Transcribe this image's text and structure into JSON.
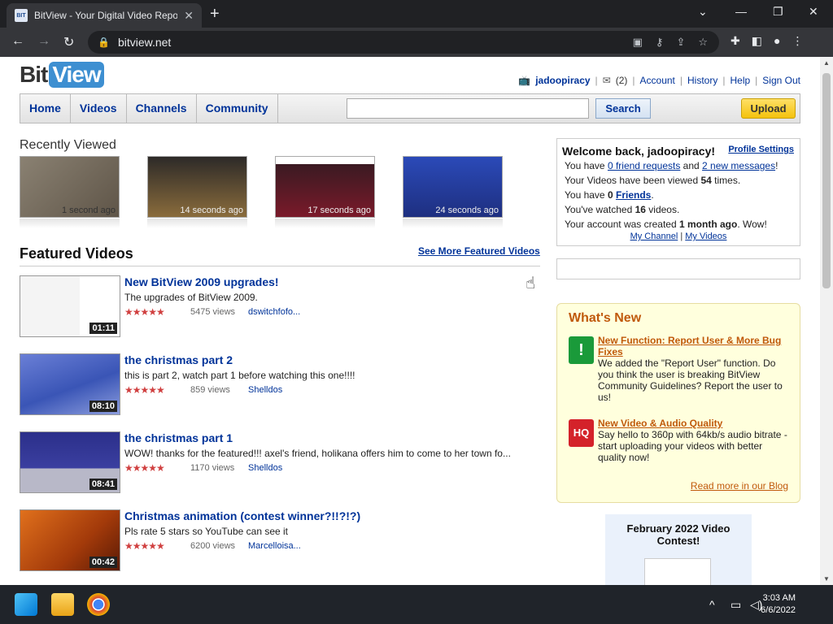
{
  "browser": {
    "tab_title": "BitView - Your Digital Video Repo",
    "favicon_text": "BIT",
    "url": "bitview.net"
  },
  "site": {
    "logo_bit": "Bit",
    "logo_view": "View",
    "user": {
      "username": "jadoopiracy",
      "message_count": "(2)",
      "links": [
        "Account",
        "History",
        "Help",
        "Sign Out"
      ]
    },
    "nav": [
      "Home",
      "Videos",
      "Channels",
      "Community"
    ],
    "search": {
      "value": "",
      "button": "Search"
    },
    "upload_label": "Upload"
  },
  "recent": {
    "title": "Recently Viewed",
    "items": [
      {
        "time": "1 second ago"
      },
      {
        "time": "14 seconds ago"
      },
      {
        "time": "17 seconds ago"
      },
      {
        "time": "24 seconds ago"
      }
    ]
  },
  "featured": {
    "title": "Featured Videos",
    "see_more": "See More Featured Videos",
    "videos": [
      {
        "title": "New BitView 2009 upgrades!",
        "desc": "The upgrades of BitView 2009.",
        "stars": "★★★★★",
        "views": "5475 views",
        "author": "dswitchfofo...",
        "duration": "01:11"
      },
      {
        "title": "the christmas part 2",
        "desc": "this is part 2, watch part 1 before watching this one!!!!",
        "stars": "★★★★★",
        "views": "859 views",
        "author": "Shelldos",
        "duration": "08:10"
      },
      {
        "title": "the christmas part 1",
        "desc": "WOW! thanks for the featured!!! axel's friend, holikana offers him to come to her town fo...",
        "stars": "★★★★★",
        "views": "1170 views",
        "author": "Shelldos",
        "duration": "08:41"
      },
      {
        "title": "Christmas animation (contest winner?!!?!?)",
        "desc": "Pls rate 5 stars so YouTube can see it",
        "stars": "★★★★★",
        "views": "6200 views",
        "author": "Marcelloisa...",
        "duration": "00:42"
      }
    ]
  },
  "welcome": {
    "title": "Welcome back, jadoopiracy!",
    "profile_settings": "Profile Settings",
    "friend_requests": "0 friend requests",
    "new_messages": "2 new messages",
    "views_count": "54",
    "friends_count": "0",
    "watched_count": "16",
    "account_age": "1 month ago",
    "my_channel": "My Channel",
    "my_videos": "My Videos",
    "line1_prefix": "You have ",
    "line1_mid": " and ",
    "line1_suffix": "!",
    "line2_prefix": "Your Videos have been viewed ",
    "line2_suffix": " times.",
    "line3_prefix": "You have ",
    "line3_link": "Friends",
    "line3_suffix": ".",
    "line4_prefix": "You've watched ",
    "line4_suffix": " videos.",
    "line5_prefix": "Your account was created ",
    "line5_suffix": ". Wow!"
  },
  "whats_new": {
    "title": "What's New",
    "items": [
      {
        "title": "New Function: Report User & More Bug Fixes",
        "text": "We added the \"Report User\" function. Do you think the user is breaking BitView Community Guidelines? Report the user to us!",
        "icon": "warning-icon",
        "icon_label": "!"
      },
      {
        "title": "New Video & Audio Quality",
        "text": "Say hello to 360p with 64kb/s audio bitrate - start uploading your videos with better quality now!",
        "icon": "hq-icon",
        "icon_label": "HQ"
      }
    ],
    "blog_link": "Read more in our Blog"
  },
  "contest": {
    "title": "February 2022 Video Contest!"
  },
  "taskbar": {
    "time": "3:03 AM",
    "date": "6/6/2022"
  },
  "colors": {
    "link": "#003399",
    "accent": "#c0590b",
    "logo_blue": "#3d8fd1"
  }
}
